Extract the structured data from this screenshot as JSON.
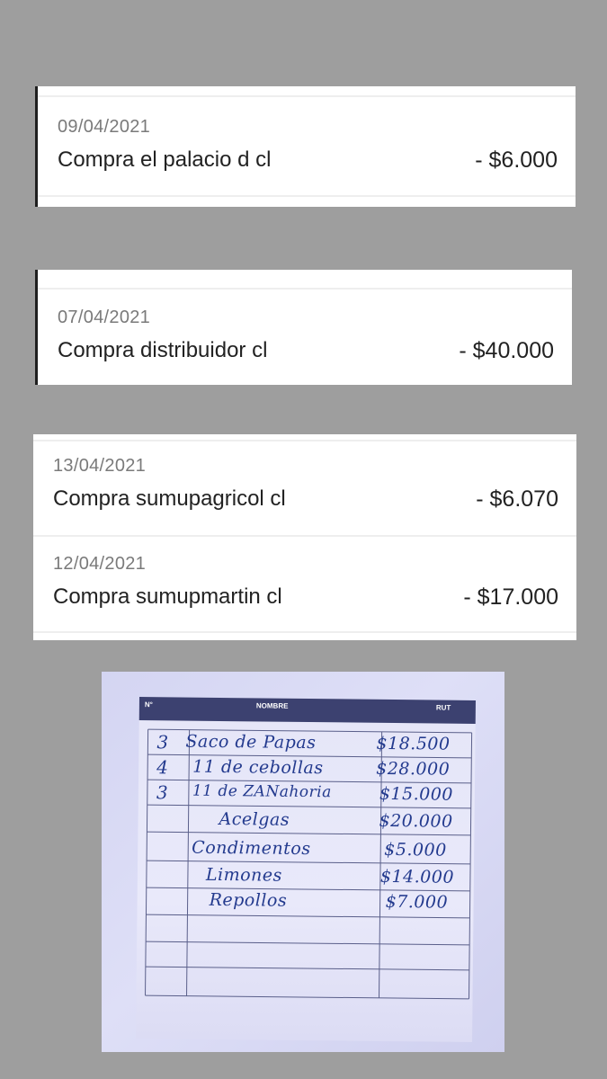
{
  "transactions": {
    "card1": [
      {
        "date": "09/04/2021",
        "description": "Compra el palacio d cl",
        "amount": "- $6.000"
      }
    ],
    "card2": [
      {
        "date": "07/04/2021",
        "description": "Compra distribuidor cl",
        "amount": "- $40.000"
      }
    ],
    "card3": [
      {
        "date": "13/04/2021",
        "description": "Compra sumupagricol cl",
        "amount": "- $6.070"
      },
      {
        "date": "12/04/2021",
        "description": "Compra sumupmartin cl",
        "amount": "- $17.000"
      }
    ]
  },
  "handwritten_sheet": {
    "headers": {
      "number": "N°",
      "name": "NOMBRE",
      "rut": "RUT"
    },
    "rows": [
      {
        "qty": "3",
        "name": "Saco de Papas",
        "price": "$18.500"
      },
      {
        "qty": "4",
        "name": "11  de cebollas",
        "price": "$28.000"
      },
      {
        "qty": "3",
        "name": "11  de ZANahoria",
        "price": "$15.000"
      },
      {
        "qty": "",
        "name": "Acelgas",
        "price": "$20.000"
      },
      {
        "qty": "",
        "name": "Condimentos",
        "price": "$5.000"
      },
      {
        "qty": "",
        "name": "Limones",
        "price": "$14.000"
      },
      {
        "qty": "",
        "name": "Repollos",
        "price": "$7.000"
      }
    ]
  },
  "colors": {
    "background": "#9e9e9e",
    "card": "#ffffff",
    "ink": "#233a8e",
    "table_header": "#3c4170"
  }
}
